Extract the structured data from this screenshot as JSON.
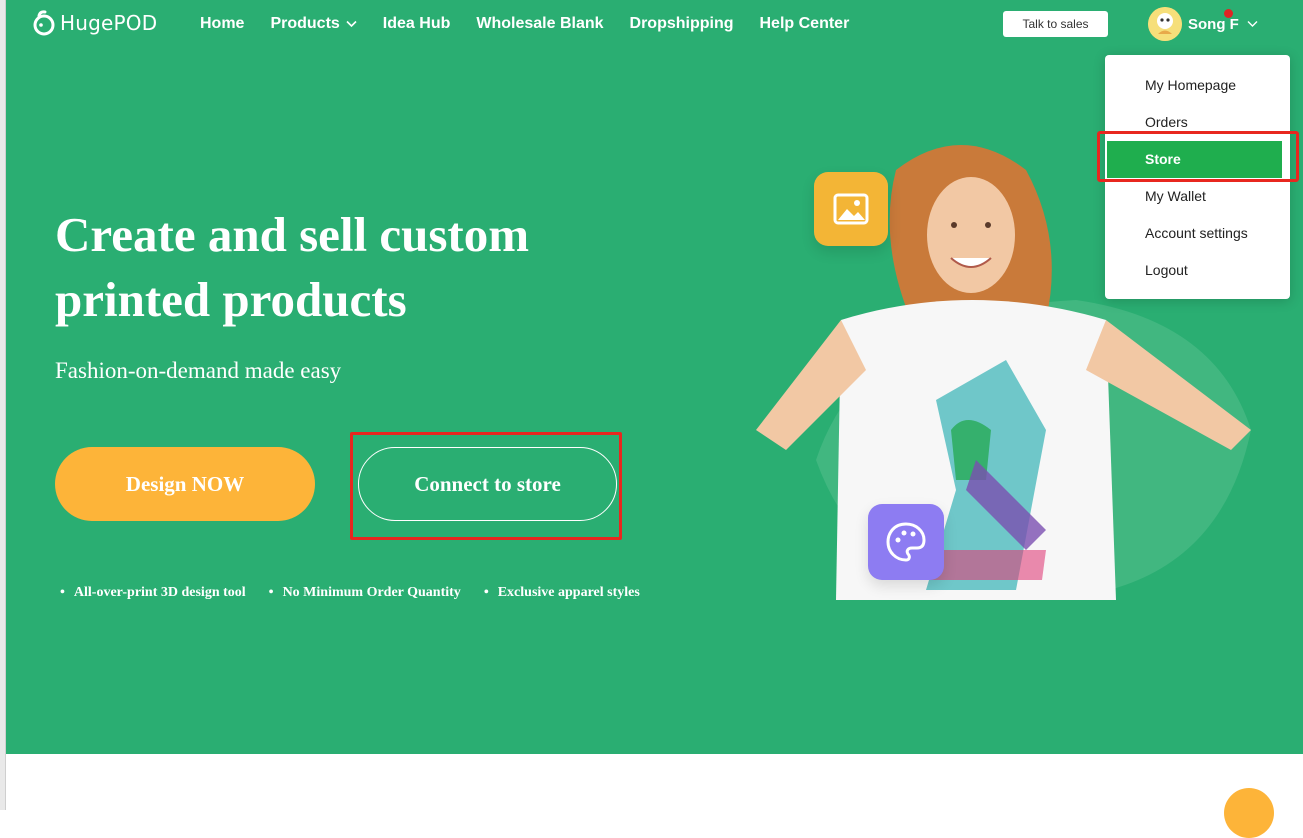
{
  "brand": {
    "name": "HugePOD",
    "color": "#2aae72"
  },
  "nav": {
    "items": [
      {
        "label": "Home"
      },
      {
        "label": "Products",
        "has_dropdown": true
      },
      {
        "label": "Idea Hub"
      },
      {
        "label": "Wholesale Blank"
      },
      {
        "label": "Dropshipping"
      },
      {
        "label": "Help Center"
      }
    ],
    "talk_to_sales": "Talk to sales",
    "user_name": "Song F"
  },
  "hero": {
    "headline": "Create and sell custom printed products",
    "subline": "Fashion-on-demand made easy",
    "design_button": "Design NOW",
    "connect_button": "Connect to store",
    "features": [
      "All-over-print 3D design tool",
      "No Minimum Order Quantity",
      "Exclusive apparel styles"
    ]
  },
  "user_menu": {
    "items": [
      "My Homepage",
      "Orders",
      "Store",
      "My Wallet",
      "Account settings",
      "Logout"
    ],
    "active": "Store"
  },
  "colors": {
    "accent_orange": "#fdb439",
    "highlight_red": "#e8271f",
    "menu_active": "#1fae4e"
  }
}
